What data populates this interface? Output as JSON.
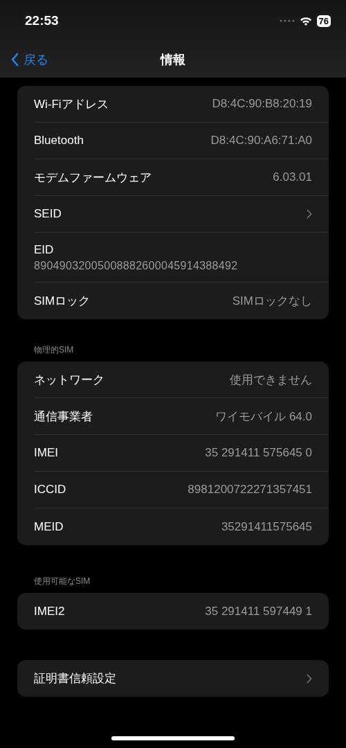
{
  "status_bar": {
    "time": "22:53",
    "battery": "76"
  },
  "nav_bar": {
    "back": "戻る",
    "title": "情報"
  },
  "groups": [
    {
      "rows": [
        {
          "kind": "value",
          "label": "Wi-Fiアドレス",
          "value": "D8:4C:90:B8:20:19"
        },
        {
          "kind": "value",
          "label": "Bluetooth",
          "value": "D8:4C:90:A6:71:A0"
        },
        {
          "kind": "value",
          "label": "モデムファームウェア",
          "value": "6.03.01"
        },
        {
          "kind": "chevron",
          "label": "SEID"
        },
        {
          "kind": "stacked",
          "label": "EID",
          "value": "89049032005008882600045914388492"
        },
        {
          "kind": "value",
          "label": "SIMロック",
          "value": "SIMロックなし"
        }
      ]
    },
    {
      "header": "物理的SIM",
      "rows": [
        {
          "kind": "value",
          "label": "ネットワーク",
          "value": "使用できません"
        },
        {
          "kind": "value",
          "label": "通信事業者",
          "value": "ワイモバイル 64.0"
        },
        {
          "kind": "value",
          "label": "IMEI",
          "value": "35 291411 575645 0"
        },
        {
          "kind": "value",
          "label": "ICCID",
          "value": "8981200722271357451"
        },
        {
          "kind": "value",
          "label": "MEID",
          "value": "35291411575645"
        }
      ]
    },
    {
      "header": "使用可能なSIM",
      "rows": [
        {
          "kind": "value",
          "label": "IMEI2",
          "value": "35 291411 597449 1"
        }
      ]
    },
    {
      "rows": [
        {
          "kind": "chevron",
          "label": "証明書信頼設定"
        }
      ]
    }
  ]
}
